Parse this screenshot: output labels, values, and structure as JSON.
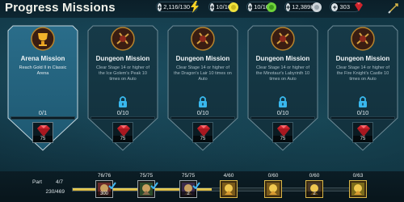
{
  "header": {
    "title": "Progress Missions",
    "resources": [
      {
        "name": "energy",
        "value": "2,116/130",
        "icon": "lightning-icon",
        "color": "#f6d126"
      },
      {
        "name": "arena-tokens",
        "value": "10/10",
        "icon": "arena-token-icon",
        "color": "#f0e23c"
      },
      {
        "name": "tag-arena-tokens",
        "value": "10/10",
        "icon": "tag-token-icon",
        "color": "#6ed23a"
      },
      {
        "name": "silver",
        "value": "12,389K",
        "icon": "silver-icon",
        "color": "#cfd6db"
      },
      {
        "name": "gems",
        "value": "303",
        "icon": "ruby-icon",
        "color": "#d0242c"
      }
    ],
    "close_icon": "close-icon"
  },
  "missions": [
    {
      "title": "Arena Mission",
      "description": "Reach Gold II in Classic Arena",
      "progress": "0/1",
      "locked": false,
      "reward": "75",
      "emblem": "trophy-icon"
    },
    {
      "title": "Dungeon Mission",
      "description": "Clear Stage 14 or higher of the Ice Golem's Peak 10 times on Auto",
      "progress": "0/10",
      "locked": true,
      "reward": "75",
      "emblem": "dungeon-icon"
    },
    {
      "title": "Dungeon Mission",
      "description": "Clear Stage 14 or higher of the Dragon's Lair 10 times on Auto",
      "progress": "0/10",
      "locked": true,
      "reward": "75",
      "emblem": "dungeon-icon"
    },
    {
      "title": "Dungeon Mission",
      "description": "Clear Stage 14 or higher of the Minotaur's Labyrinth 10 times on Auto",
      "progress": "0/10",
      "locked": true,
      "reward": "75",
      "emblem": "dungeon-icon"
    },
    {
      "title": "Dungeon Mission",
      "description": "Clear Stage 14 or higher of the Fire Knight's Castle 10 times on Auto",
      "progress": "0/10",
      "locked": true,
      "reward": "75",
      "emblem": "dungeon-icon"
    }
  ],
  "bottom": {
    "part_label": "Part",
    "part_count": "4/7",
    "points": "230/469",
    "progress_fraction": 0.49,
    "milestones": [
      {
        "label": "76/76",
        "count": "300",
        "done": true,
        "icon": "scroll-icon"
      },
      {
        "label": "75/75",
        "count": "",
        "done": true,
        "icon": "artifact-icon"
      },
      {
        "label": "75/75",
        "count": "2",
        "done": true,
        "icon": "potion-icon"
      },
      {
        "label": "4/60",
        "count": "",
        "done": false,
        "icon": "champion-shard-icon"
      },
      {
        "label": "0/60",
        "count": "",
        "done": false,
        "icon": "champion-icon"
      },
      {
        "label": "0/60",
        "count": "2",
        "done": false,
        "icon": "mystery-shard-icon"
      },
      {
        "label": "0/63",
        "count": "",
        "done": false,
        "icon": "champion-card-icon"
      }
    ]
  }
}
